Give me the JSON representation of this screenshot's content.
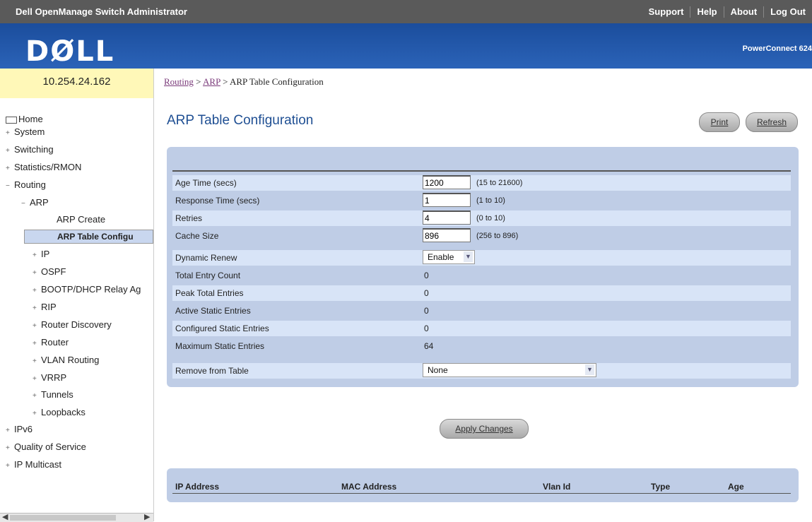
{
  "topbar": {
    "title": "Dell OpenManage Switch Administrator",
    "links": [
      "Support",
      "Help",
      "About",
      "Log Out"
    ]
  },
  "banner": {
    "logo": "DØLL",
    "product": "PowerConnect 624"
  },
  "device_ip": "10.254.24.162",
  "breadcrumb": {
    "items": [
      "Routing",
      "ARP"
    ],
    "sep": ">",
    "current": "ARP Table Configuration"
  },
  "page_title": "ARP Table Configuration",
  "buttons": {
    "print": "Print",
    "refresh": "Refresh",
    "apply": "Apply Changes"
  },
  "sidebar": {
    "items": [
      {
        "label": "Home",
        "icon": "home-icon"
      },
      {
        "label": "System",
        "toggle": "+"
      },
      {
        "label": "Switching",
        "toggle": "+"
      },
      {
        "label": "Statistics/RMON",
        "toggle": "+"
      },
      {
        "label": "Routing",
        "toggle": "−"
      },
      {
        "label": "ARP",
        "toggle": "−"
      },
      {
        "label": "ARP Create"
      },
      {
        "label": "ARP Table Configu"
      },
      {
        "label": "IP",
        "toggle": "+"
      },
      {
        "label": "OSPF",
        "toggle": "+"
      },
      {
        "label": "BOOTP/DHCP Relay Ag",
        "toggle": "+"
      },
      {
        "label": "RIP",
        "toggle": "+"
      },
      {
        "label": "Router Discovery",
        "toggle": "+"
      },
      {
        "label": "Router",
        "toggle": "+"
      },
      {
        "label": "VLAN Routing",
        "toggle": "+"
      },
      {
        "label": "VRRP",
        "toggle": "+"
      },
      {
        "label": "Tunnels",
        "toggle": "+"
      },
      {
        "label": "Loopbacks",
        "toggle": "+"
      },
      {
        "label": "IPv6",
        "toggle": "+"
      },
      {
        "label": "Quality of Service",
        "toggle": "+"
      },
      {
        "label": "IP Multicast",
        "toggle": "+"
      }
    ]
  },
  "form": {
    "age_time": {
      "label": "Age Time (secs)",
      "value": "1200",
      "hint": "(15 to 21600)"
    },
    "response_time": {
      "label": "Response Time (secs)",
      "value": "1",
      "hint": "(1 to 10)"
    },
    "retries": {
      "label": "Retries",
      "value": "4",
      "hint": "(0 to 10)"
    },
    "cache_size": {
      "label": "Cache Size",
      "value": "896",
      "hint": "(256 to 896)"
    },
    "dynamic_renew": {
      "label": "Dynamic Renew",
      "value": "Enable"
    },
    "total_entry_count": {
      "label": "Total Entry Count",
      "value": "0"
    },
    "peak_total_entries": {
      "label": "Peak Total Entries",
      "value": "0"
    },
    "active_static_entries": {
      "label": "Active Static Entries",
      "value": "0"
    },
    "configured_static_entries": {
      "label": "Configured Static Entries",
      "value": "0"
    },
    "maximum_static_entries": {
      "label": "Maximum Static Entries",
      "value": "64"
    },
    "remove_from_table": {
      "label": "Remove from Table",
      "value": "None"
    }
  },
  "arp_table": {
    "columns": [
      "IP Address",
      "MAC Address",
      "Vlan Id",
      "Type",
      "Age"
    ]
  }
}
